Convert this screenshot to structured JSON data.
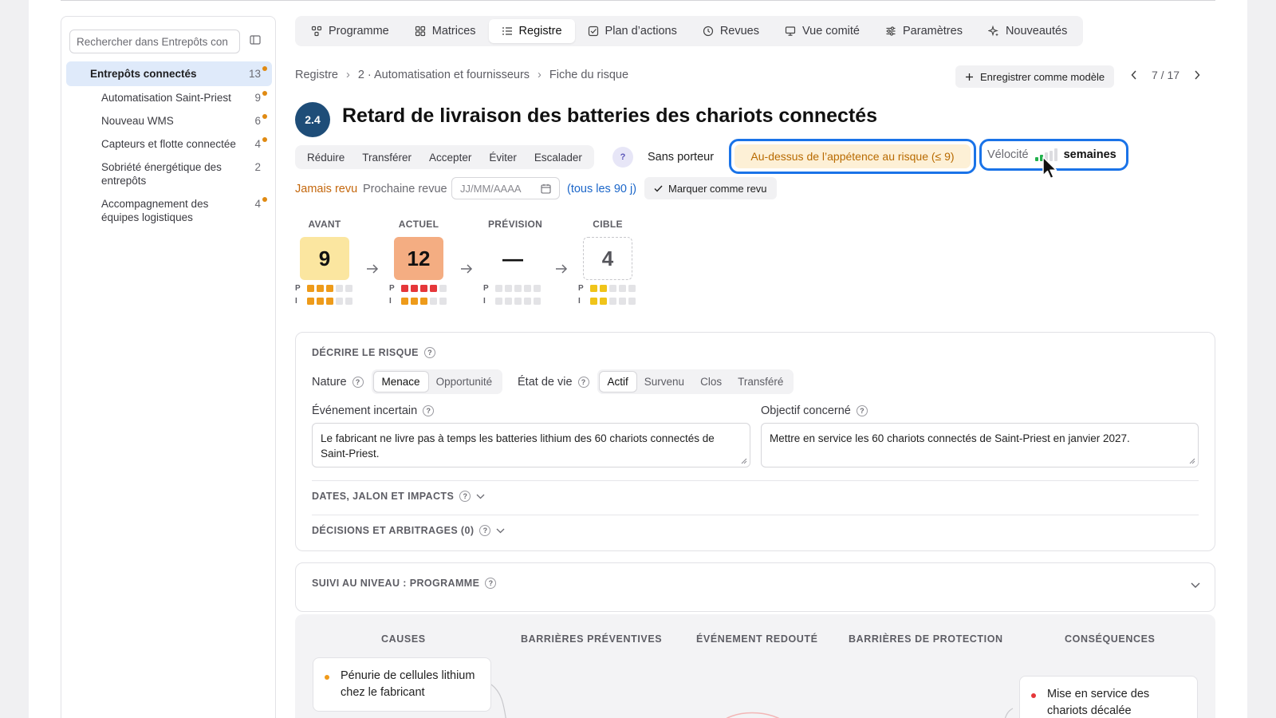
{
  "sidebar": {
    "search_placeholder": "Rechercher dans Entrepôts con",
    "items": [
      {
        "label": "Entrepôts connectés",
        "count": "13",
        "dot": true
      },
      {
        "label": "Automatisation Saint-Priest",
        "count": "9",
        "dot": true
      },
      {
        "label": "Nouveau WMS",
        "count": "6",
        "dot": true
      },
      {
        "label": "Capteurs et flotte connectée",
        "count": "4",
        "dot": true
      },
      {
        "label": "Sobriété énergétique des entrepôts",
        "count": "2",
        "dot": false
      },
      {
        "label": "Accompagnement des équipes logistiques",
        "count": "4",
        "dot": true
      }
    ]
  },
  "tabs": [
    {
      "label": "Programme",
      "icon": "program-icon"
    },
    {
      "label": "Matrices",
      "icon": "grid-icon"
    },
    {
      "label": "Registre",
      "icon": "list-icon",
      "active": true
    },
    {
      "label": "Plan d’actions",
      "icon": "checkbox-icon"
    },
    {
      "label": "Revues",
      "icon": "clock-icon"
    },
    {
      "label": "Vue comité",
      "icon": "monitor-icon"
    },
    {
      "label": "Paramètres",
      "icon": "sliders-icon"
    },
    {
      "label": "Nouveautés",
      "icon": "sparkle-icon"
    }
  ],
  "breadcrumb": {
    "root": "Registre",
    "sep": "›",
    "section": "2 · Automatisation et fournisseurs",
    "page": "Fiche du risque"
  },
  "toolbar": {
    "save_model_label": "Enregistrer comme modèle",
    "pager": "7 / 17"
  },
  "risk": {
    "id": "2.4",
    "title": "Retard de livraison des batteries des chariots connectés",
    "actions": [
      "Réduire",
      "Transférer",
      "Accepter",
      "Éviter",
      "Escalader"
    ],
    "owner_help": "?",
    "owner": "Sans porteur",
    "appetite": "Au-dessus de l’appétence au risque (≤ 9)",
    "velocity_label": "Vélocité",
    "velocity_level": 2,
    "velocity_max": 5,
    "velocity_unit": "semaines"
  },
  "review": {
    "status": "Jamais revu",
    "next_label": "Prochaine revue",
    "date_placeholder": "JJ/MM/AAAA",
    "frequency": "(tous les 90 j)",
    "mark_label": "Marquer comme revu"
  },
  "scores": [
    {
      "label": "AVANT",
      "value": "9",
      "bg": "#fbe6a0",
      "p": 3,
      "i": 3,
      "color": "#ee9b1a"
    },
    {
      "label": "ACTUEL",
      "value": "12",
      "bg": "#f4ad82",
      "p": 4,
      "i": 3,
      "pcolor": "#e5373a",
      "color": "#ee9b1a"
    },
    {
      "label": "PRÉVISION",
      "value": "—",
      "bg": "none",
      "p": 0,
      "i": 0,
      "color": "#e3e3e6"
    },
    {
      "label": "CIBLE",
      "value": "4",
      "bg": "dashed",
      "p": 2,
      "i": 2,
      "color": "#f0c419"
    }
  ],
  "pi_labels": {
    "p": "P",
    "i": "I"
  },
  "describe": {
    "title": "DÉCRIRE LE RISQUE",
    "nature_label": "Nature",
    "nature_options": [
      "Menace",
      "Opportunité"
    ],
    "nature_selected": "Menace",
    "state_label": "État de vie",
    "state_options": [
      "Actif",
      "Survenu",
      "Clos",
      "Transféré"
    ],
    "state_selected": "Actif",
    "event_label": "Événement incertain",
    "event_value": "Le fabricant ne livre pas à temps les batteries lithium des 60 chariots connectés de Saint-Priest.",
    "objective_label": "Objectif concerné",
    "objective_value": "Mettre en service les 60 chariots connectés de Saint-Priest en janvier 2027.",
    "dates_title": "DATES, JALON ET IMPACTS",
    "decisions_title": "DÉCISIONS ET ARBITRAGES (0)"
  },
  "followup": {
    "title": "SUIVI AU NIVEAU : PROGRAMME"
  },
  "bowtie": {
    "columns": [
      "CAUSES",
      "BARRIÈRES PRÉVENTIVES",
      "ÉVÉNEMENT REDOUTÉ",
      "BARRIÈRES DE PROTECTION",
      "CONSÉQUENCES"
    ],
    "cause": "Pénurie de cellules lithium chez le fabricant",
    "consequence": "Mise en service des chariots décalée"
  }
}
